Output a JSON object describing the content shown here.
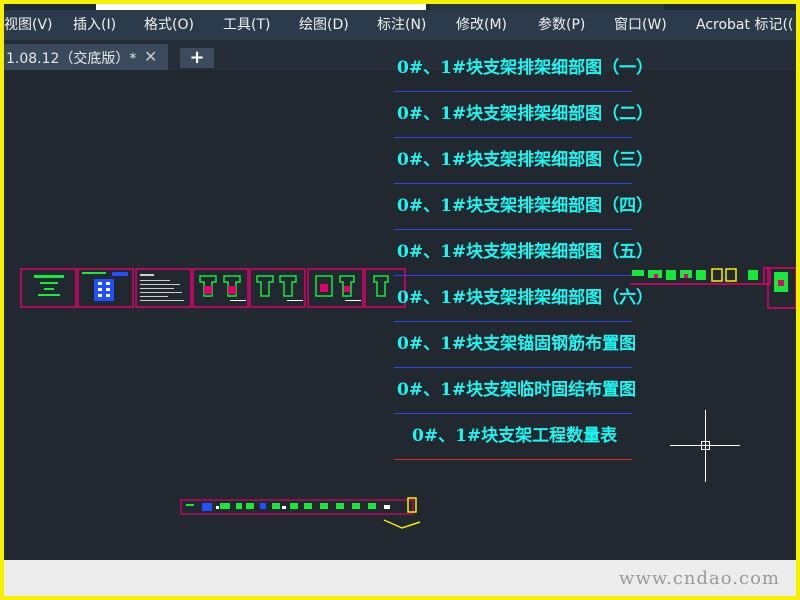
{
  "menu": {
    "items": [
      "视图(V)",
      "插入(I)",
      "格式(O)",
      "工具(T)",
      "绘图(D)",
      "标注(N)",
      "修改(M)",
      "参数(P)",
      "窗口(W)",
      "Acrobat 标记(("
    ]
  },
  "tabs": {
    "active": "1.08.12（交底版）*",
    "close": "✕",
    "add": "+"
  },
  "sheets": [
    "0#、1#块支架排架细部图（一）",
    "0#、1#块支架排架细部图（二）",
    "0#、1#块支架排架细部图（三）",
    "0#、1#块支架排架细部图（四）",
    "0#、1#块支架排架细部图（五）",
    "0#、1#块支架排架细部图（六）",
    "0#、1#块支架锚固钢筋布置图",
    "0#、1#块支架临时固结布置图",
    "0#、1#块支架工程数量表"
  ],
  "watermark": "www.cndao.com",
  "colors": {
    "sheet_text": "#1df5f0",
    "frame": "#e0006e",
    "accent_yellow": "#f5f100"
  }
}
